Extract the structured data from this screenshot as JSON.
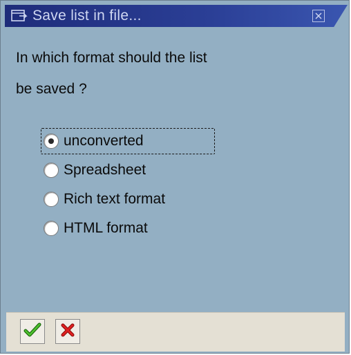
{
  "window": {
    "title": "Save list in file...",
    "title_icon": "dialog-window-icon",
    "close_icon": "close-icon"
  },
  "dialog": {
    "question_line1": "In which format should the list",
    "question_line2": "be saved ?",
    "options": [
      {
        "label": "unconverted",
        "selected": true
      },
      {
        "label": "Spreadsheet",
        "selected": false
      },
      {
        "label": "Rich text format",
        "selected": false
      },
      {
        "label": "HTML format",
        "selected": false
      }
    ]
  },
  "footer": {
    "buttons": [
      {
        "name": "confirm",
        "icon": "checkmark-icon",
        "color": "#2f9a1c"
      },
      {
        "name": "cancel",
        "icon": "cancel-x-icon",
        "color": "#d01515"
      }
    ]
  },
  "colors": {
    "titlebar": "#1e2c7a",
    "body": "#93afc3",
    "footer": "#e4e0d4"
  }
}
